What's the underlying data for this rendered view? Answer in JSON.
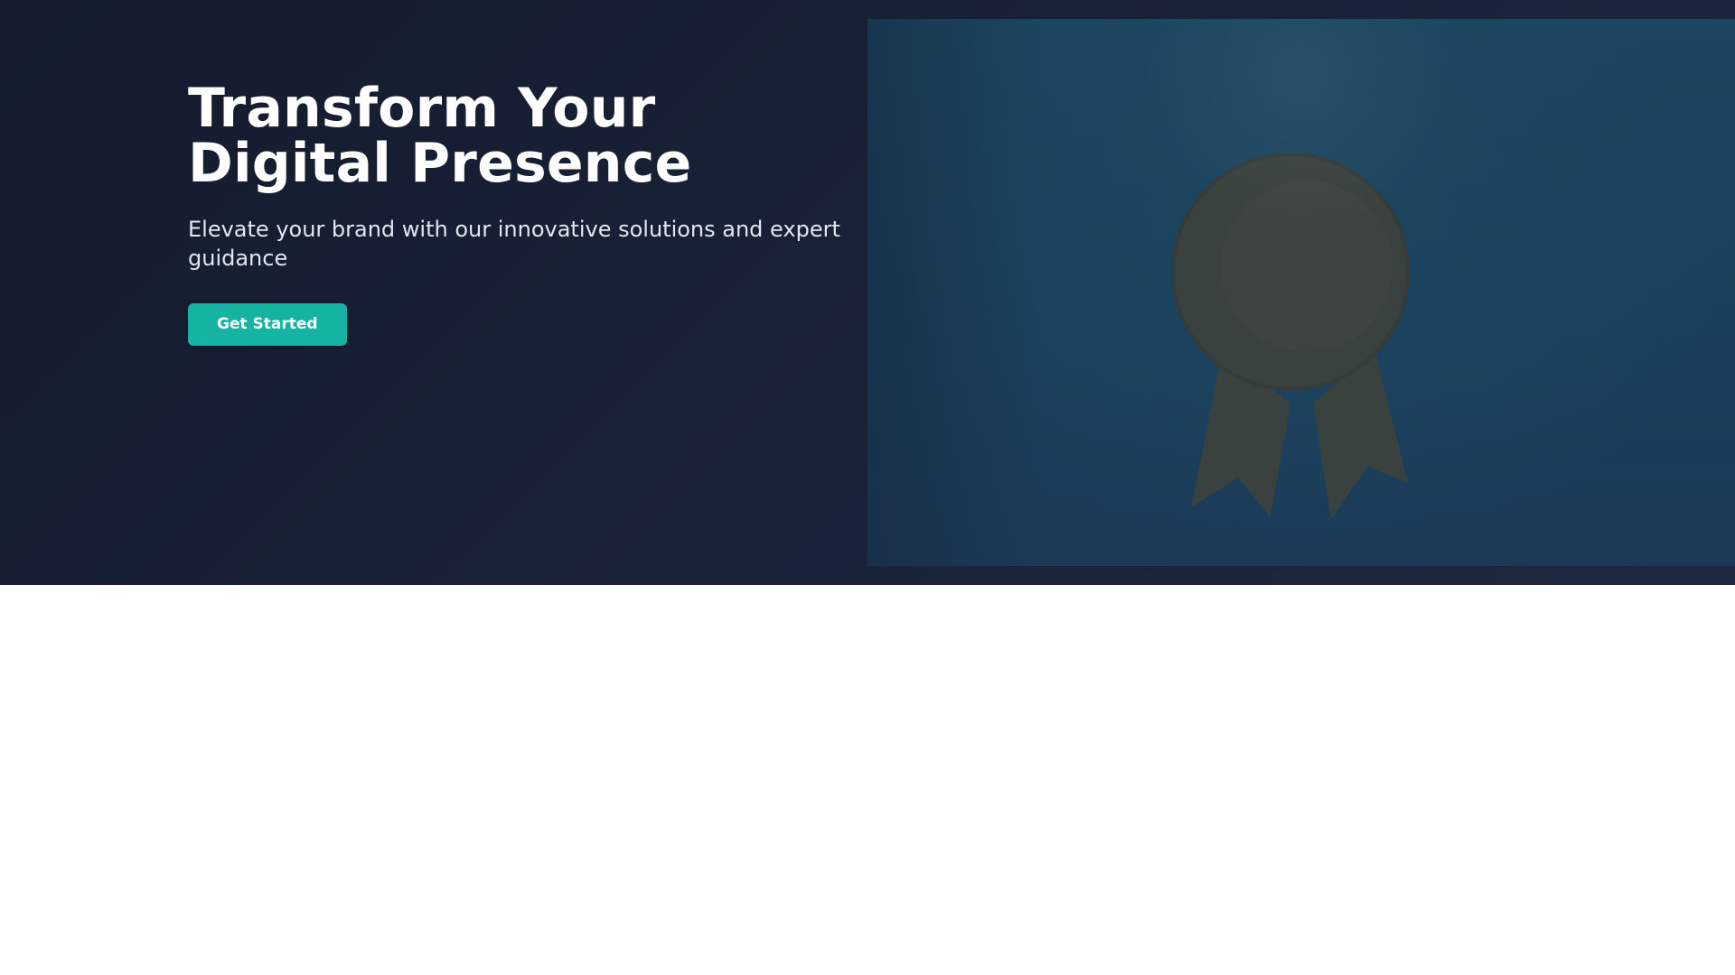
{
  "hero": {
    "title": "Transform Your Digital Presence",
    "subtitle": "Elevate your brand with our innovative solutions and expert guidance",
    "cta_label": "Get Started",
    "image_icon": "award-ribbon-icon"
  },
  "colors": {
    "hero_background": "#1a2238",
    "accent": "#14b3a2",
    "image_background": "#1a3f5c",
    "award_fill": "#3a4240",
    "page_background": "#ffffff"
  }
}
